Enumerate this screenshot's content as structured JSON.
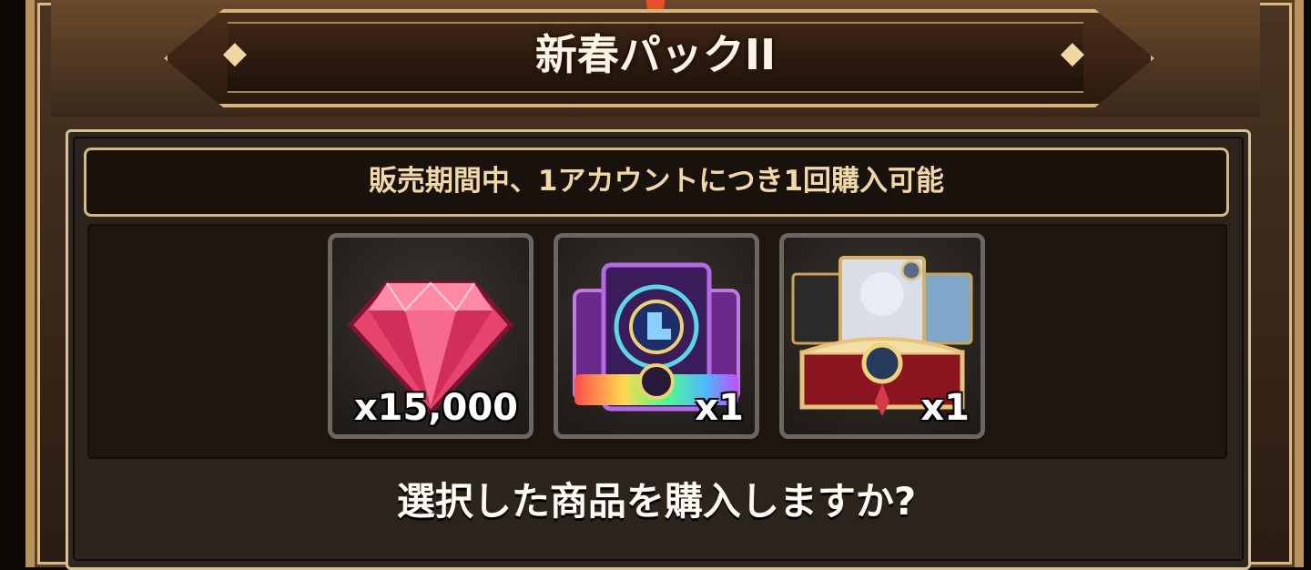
{
  "window": {
    "title": "新春パックII"
  },
  "notice": {
    "text": "販売期間中、1アカウントにつき1回購入可能"
  },
  "items": [
    {
      "name": "gem",
      "icon": "red-gem-icon",
      "quantity": "x15,000"
    },
    {
      "name": "card-pack",
      "icon": "rainbow-card-pack-icon",
      "quantity": "x1"
    },
    {
      "name": "character-chest",
      "icon": "character-chest-icon",
      "quantity": "x1"
    }
  ],
  "prompt": {
    "question": "選択した商品を購入しますか?"
  },
  "colors": {
    "accent_gold": "#d6b77c",
    "notice_text": "#f1d8a6",
    "gem": "#e8456e"
  }
}
